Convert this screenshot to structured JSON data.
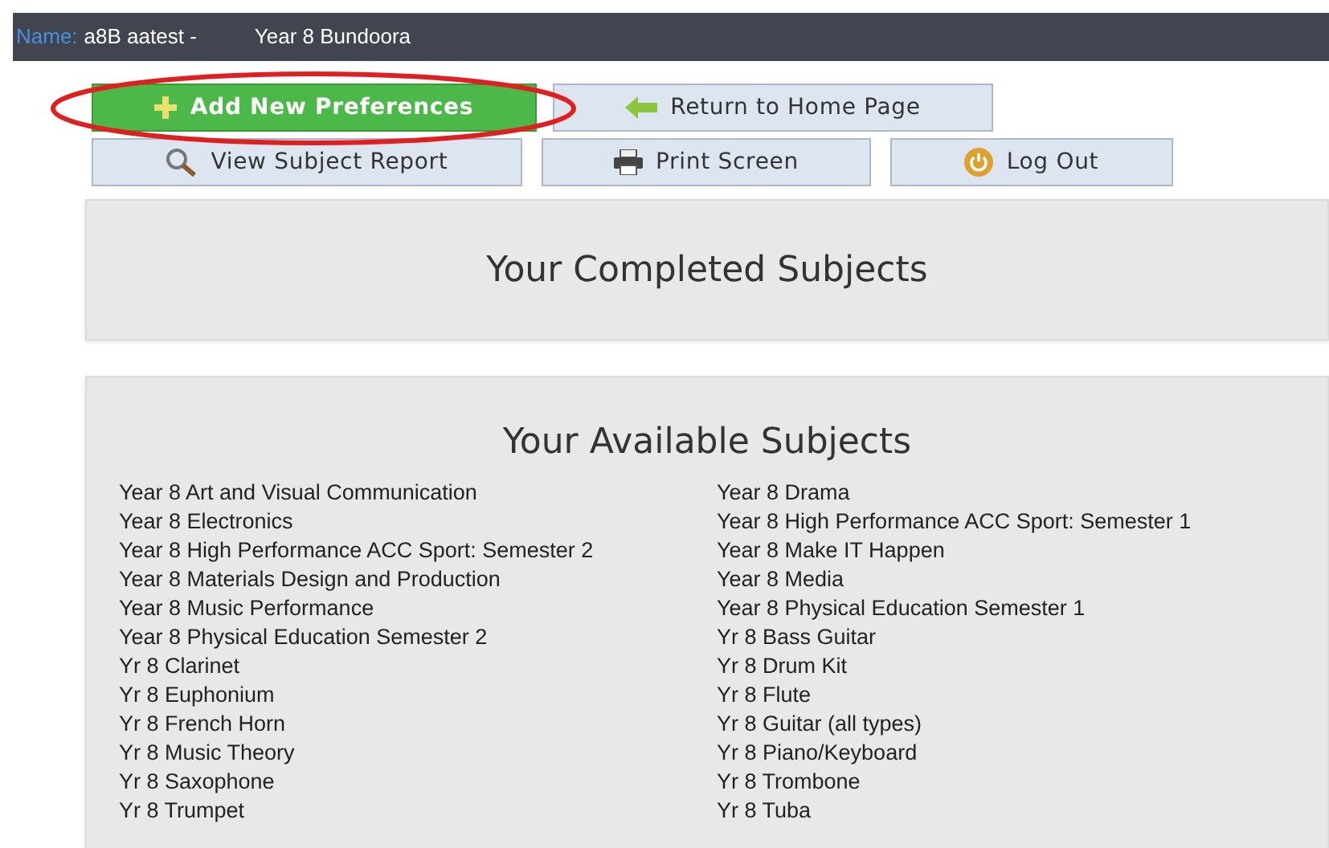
{
  "header": {
    "name_label": "Name:",
    "name_value": "a8B aatest -",
    "campus": "Year 8 Bundoora"
  },
  "buttons": [
    {
      "label": "Add New Preferences",
      "kind": "primary"
    },
    {
      "label": "Return to Home Page",
      "kind": "default"
    },
    {
      "label": "View Subject Report",
      "kind": "default"
    },
    {
      "label": "Print Screen",
      "kind": "default"
    },
    {
      "label": "Log Out",
      "kind": "default"
    }
  ],
  "completed_panel": {
    "title": "Your Completed Subjects"
  },
  "available_panel": {
    "title": "Your Available Subjects",
    "subjects": [
      "Year 8 Art and Visual Communication",
      "Year 8 Drama",
      "Year 8 Electronics",
      "Year 8 High Performance ACC Sport: Semester 1",
      "Year 8 High Performance ACC Sport: Semester 2",
      "Year 8 Make IT Happen",
      "Year 8 Materials Design and Production",
      "Year 8 Media",
      "Year 8 Music Performance",
      "Year 8 Physical Education Semester 1",
      "Year 8 Physical Education Semester 2",
      "Yr 8 Bass Guitar",
      "Yr 8 Clarinet",
      "Yr 8 Drum Kit",
      "Yr 8 Euphonium",
      "Yr 8 Flute",
      "Yr 8 French Horn",
      "Yr 8 Guitar (all types)",
      "Yr 8 Music Theory",
      "Yr 8 Piano/Keyboard",
      "Yr 8 Saxophone",
      "Yr 8 Trombone",
      "Yr 8 Trumpet",
      "Yr 8 Tuba"
    ]
  }
}
